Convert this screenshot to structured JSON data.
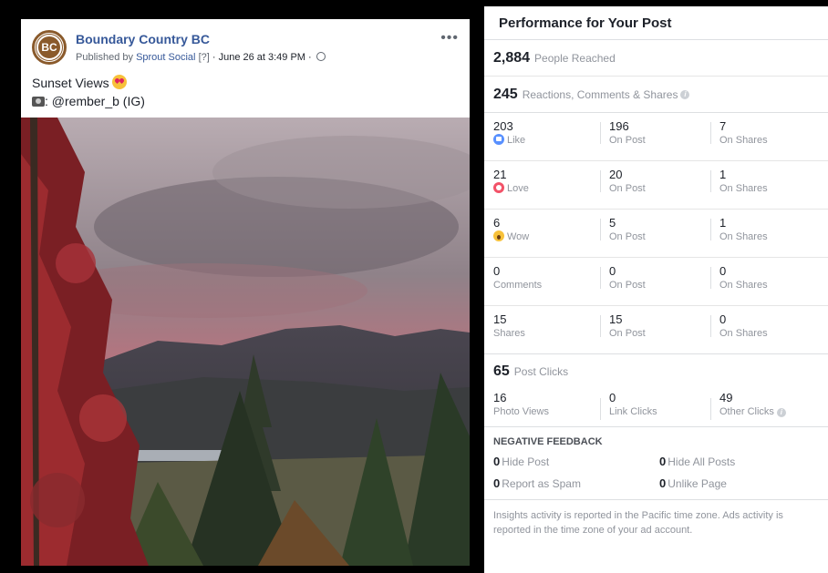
{
  "post": {
    "page_name": "Boundary Country BC",
    "avatar_text": "BC",
    "published_prefix": "Published by",
    "published_by": "Sprout Social",
    "published_help": "[?]",
    "published_date": "· June 26 at 3:49 PM ·",
    "more_label": "•••",
    "text_line1": "Sunset Views",
    "text_line2": ": @rember_b (IG)"
  },
  "panel": {
    "title": "Performance for Your Post",
    "people_reached": {
      "value": "2,884",
      "label": "People Reached"
    },
    "engagement": {
      "value": "245",
      "label": "Reactions, Comments & Shares"
    },
    "reactions": [
      {
        "total": "203",
        "label": "Like",
        "on_post": "196",
        "on_post_label": "On Post",
        "on_shares": "7",
        "on_shares_label": "On Shares"
      },
      {
        "total": "21",
        "label": "Love",
        "on_post": "20",
        "on_post_label": "On Post",
        "on_shares": "1",
        "on_shares_label": "On Shares"
      },
      {
        "total": "6",
        "label": "Wow",
        "on_post": "5",
        "on_post_label": "On Post",
        "on_shares": "1",
        "on_shares_label": "On Shares"
      },
      {
        "total": "0",
        "label": "Comments",
        "on_post": "0",
        "on_post_label": "On Post",
        "on_shares": "0",
        "on_shares_label": "On Shares"
      },
      {
        "total": "15",
        "label": "Shares",
        "on_post": "15",
        "on_post_label": "On Post",
        "on_shares": "0",
        "on_shares_label": "On Shares"
      }
    ],
    "post_clicks": {
      "value": "65",
      "label": "Post Clicks"
    },
    "clicks": [
      {
        "value": "16",
        "label": "Photo Views"
      },
      {
        "value": "0",
        "label": "Link Clicks"
      },
      {
        "value": "49",
        "label": "Other Clicks"
      }
    ],
    "negative": {
      "title": "NEGATIVE FEEDBACK",
      "hide_post": {
        "value": "0",
        "label": "Hide Post"
      },
      "hide_all": {
        "value": "0",
        "label": "Hide All Posts"
      },
      "spam": {
        "value": "0",
        "label": "Report as Spam"
      },
      "unlike": {
        "value": "0",
        "label": "Unlike Page"
      }
    },
    "footnote": "Insights activity is reported in the Pacific time zone. Ads activity is reported in the time zone of your ad account."
  },
  "colors": {
    "link_blue": "#365899",
    "like_blue": "#5890ff",
    "love_red": "#f25268",
    "wow_yellow": "#f7c13a",
    "brand_brown": "#8a5a2b"
  }
}
